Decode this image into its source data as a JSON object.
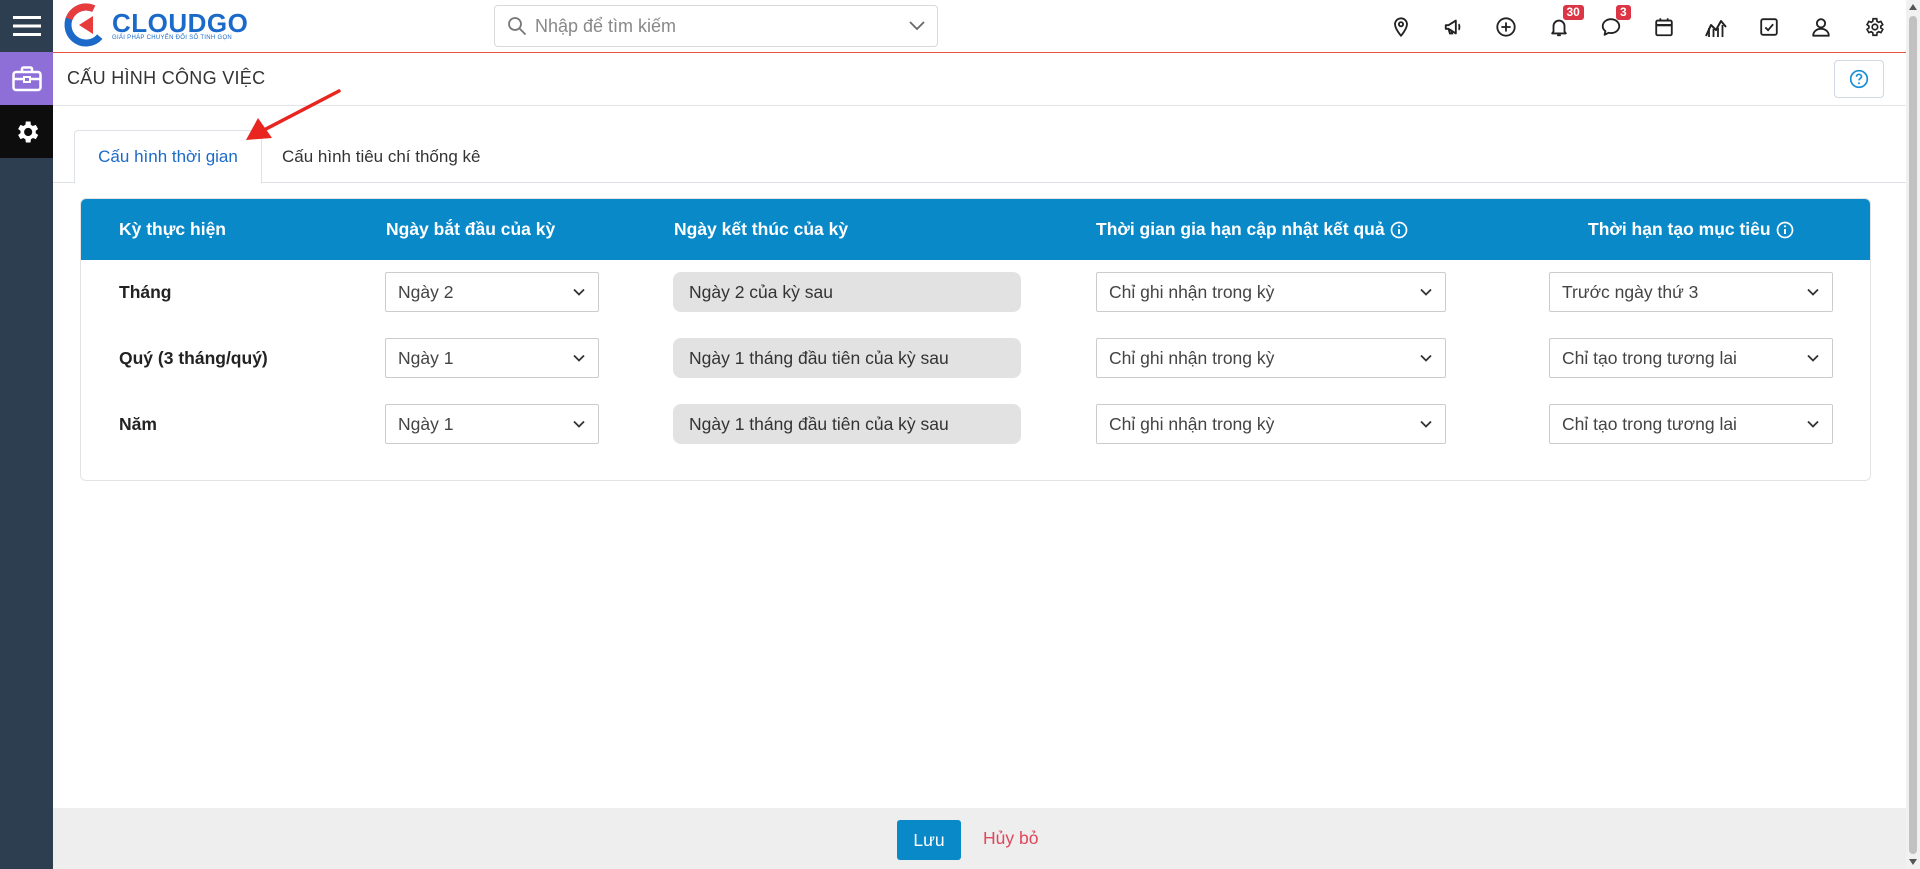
{
  "app": {
    "logo_name": "CLOUDGO",
    "logo_tagline": "GIẢI PHÁP CHUYỂN ĐỔI SỐ TINH GỌN"
  },
  "search": {
    "placeholder": "Nhập để tìm kiếm"
  },
  "header_icons": [
    {
      "name": "location-icon"
    },
    {
      "name": "megaphone-icon"
    },
    {
      "name": "add-circle-icon"
    },
    {
      "name": "bell-icon",
      "badge": "30"
    },
    {
      "name": "chat-icon",
      "badge": "3"
    },
    {
      "name": "calendar-icon"
    },
    {
      "name": "chart-icon"
    },
    {
      "name": "task-check-icon"
    },
    {
      "name": "user-icon"
    },
    {
      "name": "settings-icon"
    }
  ],
  "page": {
    "title": "CẤU HÌNH CÔNG VIỆC"
  },
  "tabs": [
    {
      "label": "Cấu hình thời gian",
      "active": true
    },
    {
      "label": "Cấu hình tiêu chí thống kê",
      "active": false
    }
  ],
  "table": {
    "headers": [
      "Kỳ thực hiện",
      "Ngày bắt đầu của kỳ",
      "Ngày kết thúc của kỳ",
      "Thời gian gia hạn cập nhật kết quả",
      "Thời hạn tạo mục tiêu"
    ],
    "rows": [
      {
        "period": "Tháng",
        "start": "Ngày 2",
        "end": "Ngày 2 của kỳ sau",
        "extension": "Chỉ ghi nhận trong kỳ",
        "deadline": "Trước ngày thứ 3"
      },
      {
        "period": "Quý (3 tháng/quý)",
        "start": "Ngày 1",
        "end": "Ngày 1 tháng đầu tiên của kỳ sau",
        "extension": "Chỉ ghi nhận trong kỳ",
        "deadline": "Chỉ tạo trong tương lai"
      },
      {
        "period": "Năm",
        "start": "Ngày 1",
        "end": "Ngày 1 tháng đầu tiên của kỳ sau",
        "extension": "Chỉ ghi nhận trong kỳ",
        "deadline": "Chỉ tạo trong tương lai"
      }
    ]
  },
  "footer": {
    "save_label": "Lưu",
    "cancel_label": "Hủy bỏ"
  },
  "colors": {
    "brand_blue": "#1b6ac9",
    "table_header": "#0a89c9",
    "sidebar": "#2d3e50",
    "sidebar_active": "#8e6fd8",
    "header_border": "#e8543b",
    "cancel_red": "#e0475b",
    "badge_red": "#dc3545"
  }
}
